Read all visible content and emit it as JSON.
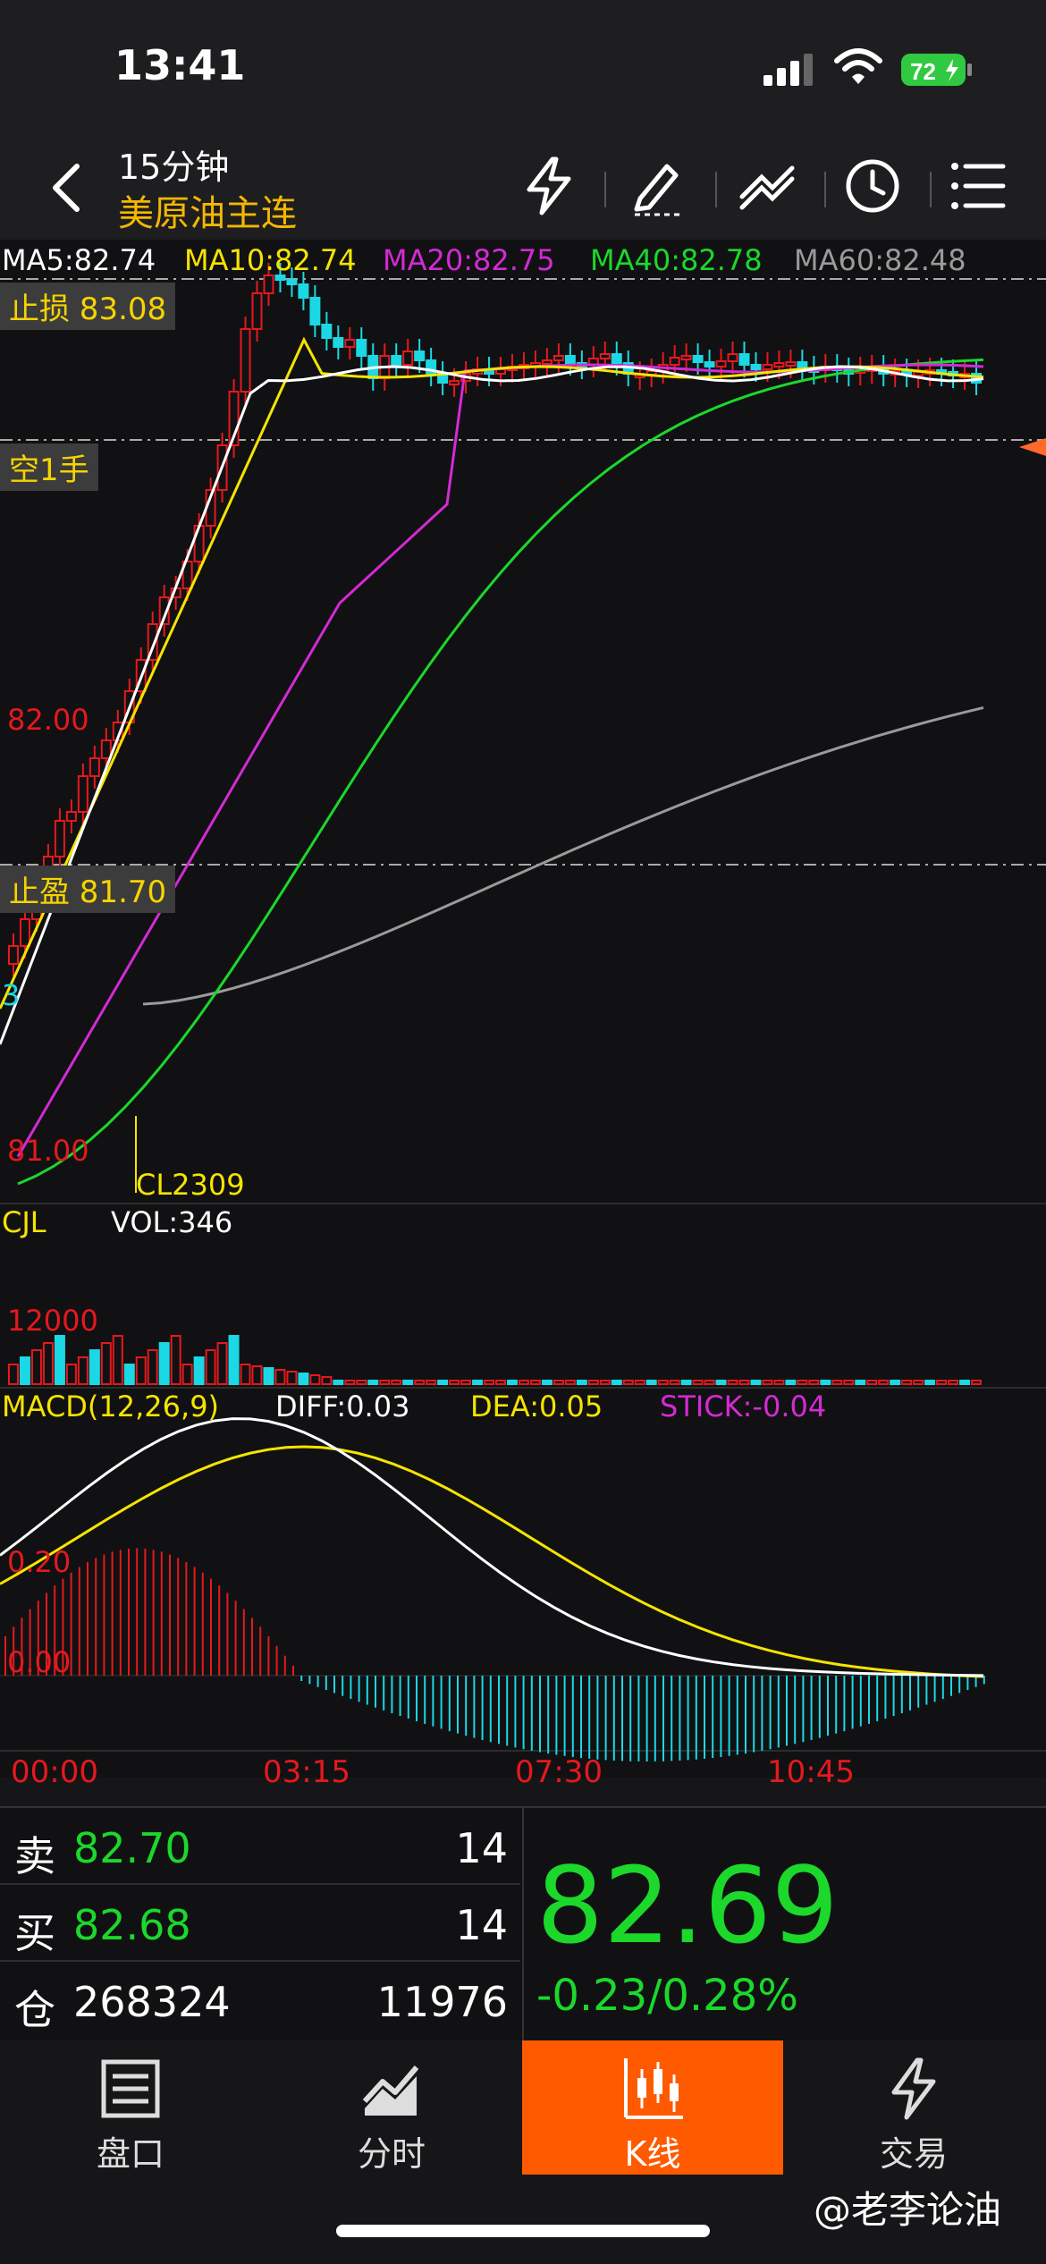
{
  "status": {
    "time": "13:41",
    "battery": "72"
  },
  "nav": {
    "period": "15分钟",
    "title": "美原油主连"
  },
  "chart": {
    "ma_legend": [
      {
        "label": "MA5:82.74",
        "color": "#ffffff"
      },
      {
        "label": "MA10:82.74",
        "color": "#f5e400"
      },
      {
        "label": "MA20:82.75",
        "color": "#d42ad4"
      },
      {
        "label": "MA40:82.78",
        "color": "#1bd82b"
      },
      {
        "label": "MA60:82.48",
        "color": "#9a9a9a"
      }
    ],
    "stop_loss": "止损 83.08",
    "short_position": "空1手",
    "take_profit": "止盈 81.70",
    "price_82": "82.00",
    "price_81": "81.00",
    "left_edge_mark": "3",
    "contract": "CL2309"
  },
  "volume": {
    "label": "CJL",
    "vol": "VOL:346",
    "scale": "12000"
  },
  "macd": {
    "label": "MACD(12,26,9)",
    "diff": "DIFF:0.03",
    "dea": "DEA:0.05",
    "stick": "STICK:-0.04",
    "level_020": "0.20",
    "level_000": "0.00"
  },
  "time_axis": [
    "00:00",
    "03:15",
    "07:30",
    "10:45"
  ],
  "quote": {
    "sell_label": "卖",
    "sell_price": "82.70",
    "sell_qty": "14",
    "buy_label": "买",
    "buy_price": "82.68",
    "buy_qty": "14",
    "oi_label": "仓",
    "oi_value": "268324",
    "oi_change": "11976",
    "last_price": "82.69",
    "change": "-0.23/0.28%"
  },
  "tabs": [
    {
      "label": "盘口",
      "icon": "order-book-icon"
    },
    {
      "label": "分时",
      "icon": "timeshare-icon"
    },
    {
      "label": "K线",
      "icon": "candlestick-icon"
    },
    {
      "label": "交易",
      "icon": "lightning-icon"
    }
  ],
  "watermark": "@老李论油",
  "colors": {
    "up": "#e5191d",
    "down": "#1bd8e4",
    "accent": "#ff5a00",
    "price_green": "#1bd82b"
  }
}
